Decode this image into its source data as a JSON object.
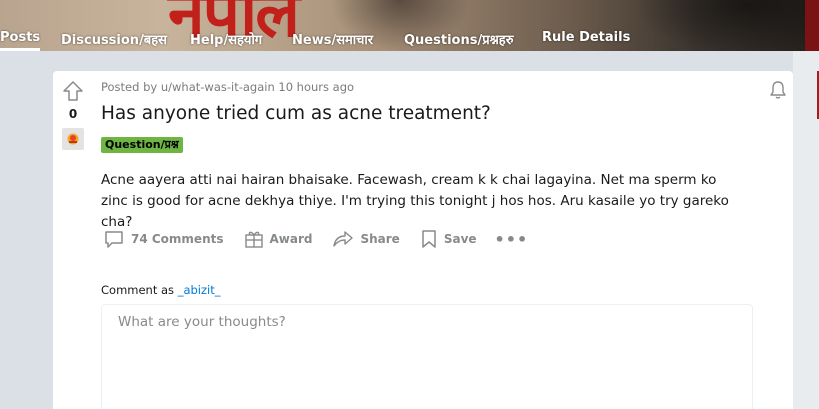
{
  "banner": {
    "title_glyphs": "नेपाल"
  },
  "nav": {
    "tabs": [
      {
        "label": "Posts",
        "active": true
      },
      {
        "label": "Discussion/बहस",
        "active": false
      },
      {
        "label": "Help/सहयोग",
        "active": false
      },
      {
        "label": "News/समाचार",
        "active": false
      },
      {
        "label": "Questions/प्रश्नहरु",
        "active": false
      },
      {
        "label": "Rule Details",
        "active": false
      }
    ]
  },
  "post": {
    "vote_count": "0",
    "meta": "Posted by u/what-was-it-again 10 hours ago",
    "title": "Has anyone tried cum as acne treatment?",
    "flair": "Question/प्रश्न",
    "body": "Acne aayera atti nai hairan bhaisake. Facewash, cream k k chai lagayina. Net ma sperm ko zinc is good for acne dekhya thiye. I'm trying this tonight j hos hos. Aru kasaile yo try gareko cha?",
    "actions": {
      "comments": "74 Comments",
      "award": "Award",
      "share": "Share",
      "save": "Save",
      "more": "•••"
    }
  },
  "comment_box": {
    "label": "Comment as",
    "username": "_abizit_",
    "placeholder": "What are your thoughts?"
  },
  "colors": {
    "flair_bg": "#6fb543",
    "username_link": "#0079d3",
    "page_bg": "#dae0e6"
  }
}
